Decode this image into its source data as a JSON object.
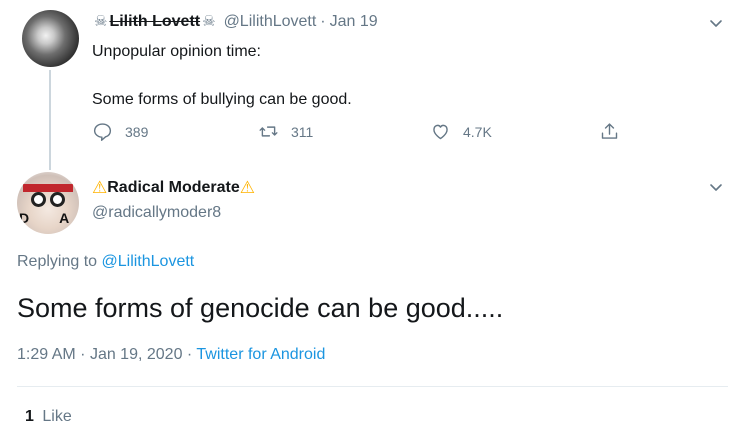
{
  "parent_tweet": {
    "name_decoration": "☠",
    "display_name": "Lilith Lovett",
    "handle": "@LilithLovett",
    "separator": "·",
    "date": "Jan 19",
    "line_1": "Unpopular opinion time:",
    "line_2": "Some forms of bullying can be good.",
    "actions": {
      "reply_count": "389",
      "retweet_count": "311",
      "like_count": "4.7K"
    }
  },
  "reply_tweet": {
    "name_decoration": "⚠",
    "display_name": "Radical Moderate",
    "handle": "@radicallymoder8",
    "avatar_text": "DA",
    "replying_label": "Replying to",
    "replying_handle": "@LilithLovett",
    "text": "Some forms of genocide can be good.....",
    "time": "1:29 AM",
    "separator_1": "·",
    "date": "Jan 19, 2020",
    "separator_2": "·",
    "source": "Twitter for Android",
    "likes_count": "1",
    "likes_label": "Like"
  },
  "colors": {
    "text_primary": "#14171a",
    "text_secondary": "#657786",
    "link": "#1b95e0",
    "divider": "#e6ecf0",
    "warning": "#ffb300"
  },
  "icons": {
    "reply": "reply-icon",
    "retweet": "retweet-icon",
    "like": "heart-icon",
    "share": "share-icon",
    "menu": "chevron-down-icon"
  }
}
